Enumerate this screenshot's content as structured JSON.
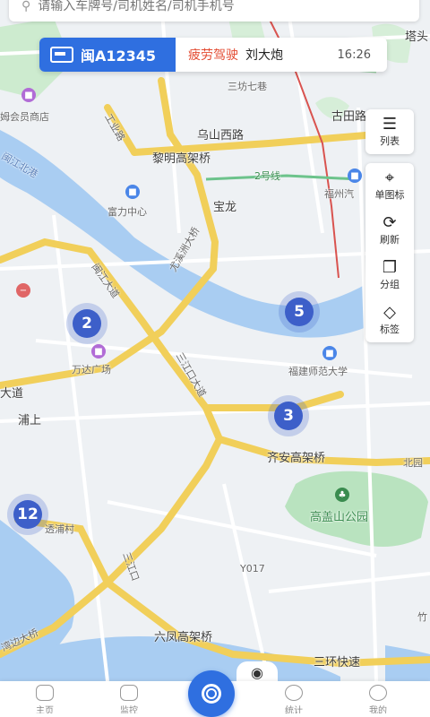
{
  "search": {
    "placeholder": "请输入车牌号/司机姓名/司机手机号",
    "icon": "search-icon"
  },
  "vehicle_card": {
    "plate": "闽A12345",
    "status": "疲劳驾驶",
    "driver": "刘大炮",
    "time": "16:26",
    "status_color": "#e34b32",
    "accent": "#2f6fe0"
  },
  "tools": {
    "list": "列表",
    "single": "单图标",
    "refresh": "刷新",
    "group": "分组",
    "tag": "标签"
  },
  "clusters": [
    "2",
    "5",
    "3",
    "12"
  ],
  "map_labels": {
    "tashan": "塔头",
    "member_store": "姆会员商店",
    "sanfang": "三坊七巷",
    "gutian": "古田路",
    "gongye": "工业路",
    "wushan": "乌山西路",
    "liming": "黎明高架桥",
    "minjiang_north": "闽江北港",
    "route2": "2号线",
    "fuzhou": "福州汽",
    "fuli": "富力中心",
    "baolong": "宝龙",
    "youxi": "尤溪洲大桥",
    "minjiang_ave": "闽江大道",
    "dadao": "大道",
    "wanda": "万达广场",
    "sanjiang": "三江口大道",
    "normal_univ": "福建师范大学",
    "pushang": "浦上",
    "qian": "齐安高架桥",
    "beiyuan": "北园",
    "gaogai": "高盖山公园",
    "tongpu": "透浦村",
    "y017": "Y017",
    "bridge_bottom": "湾边大桥",
    "liufeng": "六凤高架桥",
    "sanhuan": "三环快速",
    "zhu": "竹",
    "sanjiangkou": "三江口"
  },
  "bottom_nav": [
    "主页",
    "监控",
    "",
    "统计",
    "我的"
  ]
}
